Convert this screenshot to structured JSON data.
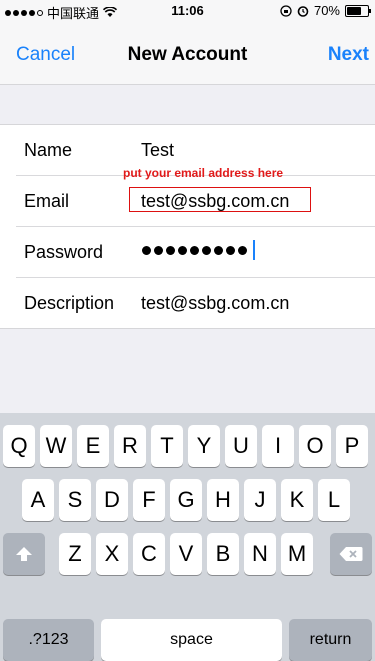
{
  "status_bar": {
    "carrier": "中国联通",
    "time": "11:06",
    "battery": "70%",
    "battery_fraction": 0.7
  },
  "nav": {
    "cancel": "Cancel",
    "title": "New Account",
    "next": "Next"
  },
  "form": {
    "name_label": "Name",
    "name_value": "Test",
    "email_label": "Email",
    "email_value": "test@ssbg.com.cn",
    "email_hint": "put your email address here",
    "password_label": "Password",
    "password_length": 9,
    "description_label": "Description",
    "description_value": "test@ssbg.com.cn"
  },
  "keyboard": {
    "row1": [
      "Q",
      "W",
      "E",
      "R",
      "T",
      "Y",
      "U",
      "I",
      "O",
      "P"
    ],
    "row2": [
      "A",
      "S",
      "D",
      "F",
      "G",
      "H",
      "J",
      "K",
      "L"
    ],
    "row3": [
      "Z",
      "X",
      "C",
      "V",
      "B",
      "N",
      "M"
    ],
    "numbers_key": ".?123",
    "space_key": "space",
    "return_key": "return",
    "shift_icon": "shift-icon",
    "delete_icon": "delete-icon"
  },
  "colors": {
    "accent": "#1a82fb",
    "hint_red": "#e11a1a"
  }
}
